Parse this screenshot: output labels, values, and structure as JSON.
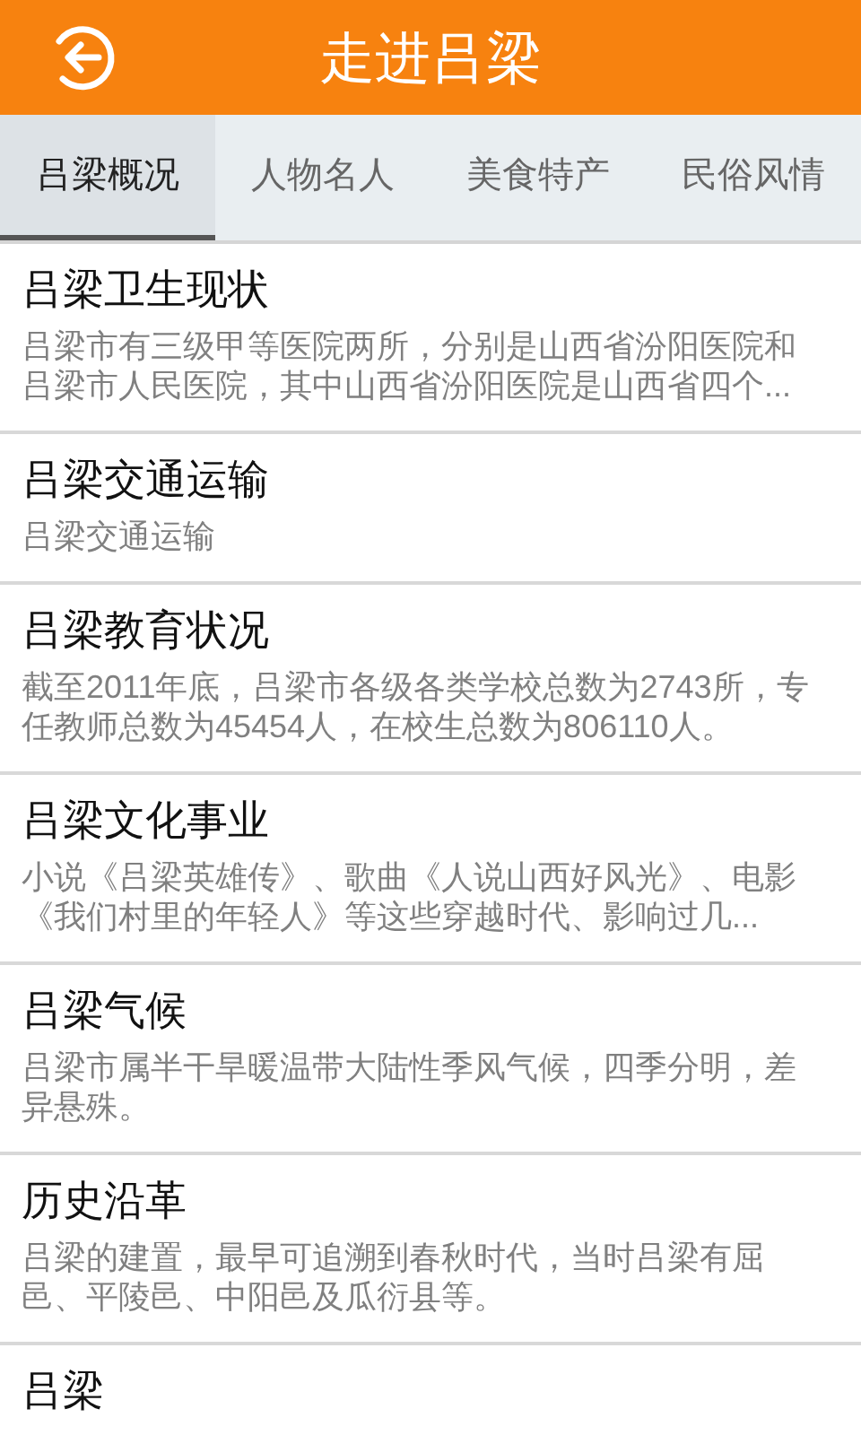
{
  "header": {
    "title": "走进吕梁"
  },
  "tabs": [
    {
      "label": "吕梁概况",
      "selected": true
    },
    {
      "label": "人物名人",
      "selected": false
    },
    {
      "label": "美食特产",
      "selected": false
    },
    {
      "label": "民俗风情",
      "selected": false
    }
  ],
  "articles": [
    {
      "title": "吕梁卫生现状",
      "summary": "吕梁市有三级甲等医院两所，分别是山西省汾阳医院和吕梁市人民医院，其中山西省汾阳医院是山西省四个..."
    },
    {
      "title": "吕梁交通运输",
      "summary": "吕梁交通运输"
    },
    {
      "title": "吕梁教育状况",
      "summary": "截至2011年底，吕梁市各级各类学校总数为2743所，专任教师总数为45454人，在校生总数为806110人。"
    },
    {
      "title": "吕梁文化事业",
      "summary": "小说《吕梁英雄传》、歌曲《人说山西好风光》、电影《我们村里的年轻人》等这些穿越时代、影响过几..."
    },
    {
      "title": "吕梁气候",
      "summary": "吕梁市属半干旱暖温带大陆性季风气候，四季分明，差异悬殊。"
    },
    {
      "title": "历史沿革",
      "summary": "吕梁的建置，最早可追溯到春秋时代，当时吕梁有屈邑、平陵邑、中阳邑及瓜衍县等。"
    },
    {
      "title": "吕梁"
    }
  ]
}
